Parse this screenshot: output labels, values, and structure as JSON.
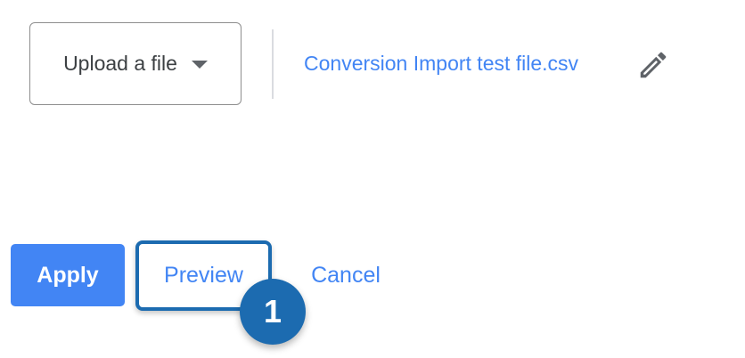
{
  "upload": {
    "label": "Upload a file"
  },
  "file": {
    "name": "Conversion Import test file.csv"
  },
  "actions": {
    "apply_label": "Apply",
    "preview_label": "Preview",
    "cancel_label": "Cancel"
  },
  "callout": {
    "step_number": "1"
  },
  "colors": {
    "primary_blue": "#4285f4",
    "callout_blue": "#1c6bb0",
    "border_gray": "#8e8e8e",
    "text_dark": "#3c4043"
  },
  "icons": {
    "dropdown": "caret-down-icon",
    "edit": "pencil-icon"
  }
}
